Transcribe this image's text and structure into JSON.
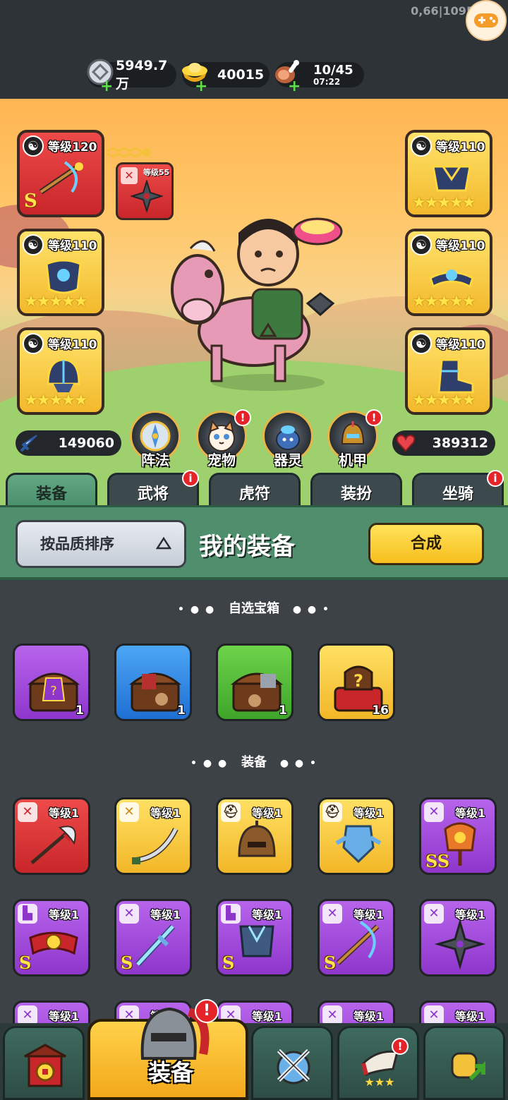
{
  "debug": "0,66|1095",
  "resources": {
    "silver": "5949.7万",
    "gold": "40015",
    "stamina": "10/45",
    "stamina_timer": "07:22"
  },
  "hero": {
    "slots_left": [
      {
        "level": "等级120",
        "quality": "red",
        "badge": "S"
      },
      {
        "level": "等级110",
        "quality": "gold",
        "stars": "★★★★★"
      },
      {
        "level": "等级110",
        "quality": "gold",
        "stars": "★★★★★"
      }
    ],
    "sub_slot": {
      "level": "等级55"
    },
    "slots_right": [
      {
        "level": "等级110",
        "quality": "gold",
        "stars": "★★★★★"
      },
      {
        "level": "等级110",
        "quality": "gold",
        "stars": "★★★★★"
      },
      {
        "level": "等级110",
        "quality": "gold",
        "stars": "★★★★★"
      }
    ],
    "attack": "149060",
    "hp": "389312"
  },
  "feature_buttons": [
    {
      "label": "阵法",
      "alert": false
    },
    {
      "label": "宠物",
      "alert": true
    },
    {
      "label": "器灵",
      "alert": false
    },
    {
      "label": "机甲",
      "alert": true
    }
  ],
  "tabs": [
    {
      "label": "装备",
      "active": true,
      "alert": false
    },
    {
      "label": "武将",
      "active": false,
      "alert": true
    },
    {
      "label": "虎符",
      "active": false,
      "alert": false
    },
    {
      "label": "装扮",
      "active": false,
      "alert": false
    },
    {
      "label": "坐骑",
      "active": false,
      "alert": true
    }
  ],
  "sortbar": {
    "sort_label": "按品质排序",
    "title": "我的装备",
    "merge_label": "合成"
  },
  "chest_section": {
    "title": "自选宝箱",
    "dots_left": "• ● ●",
    "dots_right": "● ● •",
    "items": [
      {
        "quality": "purple",
        "count": "1"
      },
      {
        "quality": "blue",
        "count": "1"
      },
      {
        "quality": "green",
        "count": "1"
      },
      {
        "quality": "gold",
        "count": "16"
      }
    ]
  },
  "equip_section": {
    "title": "装备",
    "row1": [
      {
        "quality": "red",
        "level": "等级1",
        "icon": "sword-icon"
      },
      {
        "quality": "gold",
        "level": "等级1",
        "icon": "sword-icon"
      },
      {
        "quality": "gold",
        "level": "等级1",
        "icon": "helmet-icon"
      },
      {
        "quality": "gold",
        "level": "等级1",
        "icon": "helmet-icon"
      },
      {
        "quality": "purple",
        "level": "等级1",
        "icon": "sword-icon",
        "badge": "SS"
      }
    ],
    "row2": [
      {
        "quality": "purple",
        "level": "等级1",
        "icon": "boot-icon",
        "badge": "S"
      },
      {
        "quality": "purple",
        "level": "等级1",
        "icon": "sword-icon",
        "badge": "S"
      },
      {
        "quality": "purple",
        "level": "等级1",
        "icon": "boot-icon",
        "badge": "S"
      },
      {
        "quality": "purple",
        "level": "等级1",
        "icon": "sword-icon",
        "badge": "S"
      },
      {
        "quality": "purple",
        "level": "等级1",
        "icon": "sword-icon"
      }
    ],
    "row3_levels": [
      "等级1",
      "等级1",
      "等级1",
      "等级1",
      "等级1"
    ]
  },
  "bottom_nav": {
    "active_label": "装备"
  },
  "colors": {
    "accent_gold": "#f7bf1d",
    "panel_green": "#4f8f6d",
    "alert_red": "#e5242a",
    "bg_dark": "#3d4247"
  }
}
